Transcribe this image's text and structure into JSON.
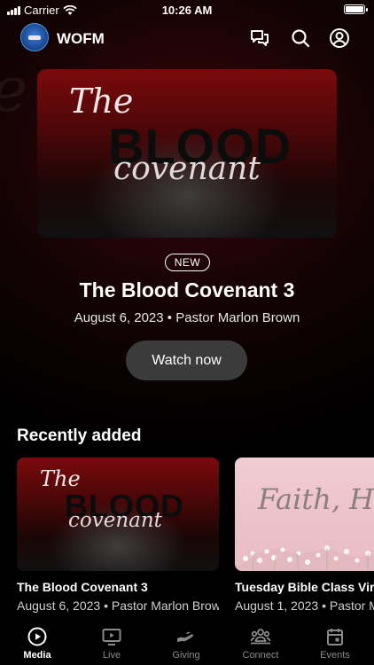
{
  "status_bar": {
    "carrier": "Carrier",
    "time": "10:26 AM"
  },
  "header": {
    "title": "WOFM",
    "icons": [
      "chat-icon",
      "search-icon",
      "profile-icon"
    ]
  },
  "hero": {
    "artwork": {
      "word1": "The",
      "word2": "BLOOD",
      "word3": "covenant"
    },
    "badge": "NEW",
    "title": "The Blood Covenant 3",
    "date": "August 6, 2023",
    "separator": "•",
    "speaker": "Pastor Marlon Brown",
    "button": "Watch now"
  },
  "recently_added": {
    "title": "Recently added",
    "items": [
      {
        "artwork": {
          "word1": "The",
          "word2": "BLOOD",
          "word3": "covenant"
        },
        "title": "The Blood Covenant 3",
        "date": "August 6, 2023",
        "separator": "•",
        "speaker": "Pastor Marlon Brown"
      },
      {
        "artwork": {
          "word1": "Faith, Hope"
        },
        "title": "Tuesday Bible Class Virtual",
        "date": "August 1, 2023",
        "separator": "•",
        "speaker": "Pastor Marlon Brown"
      }
    ]
  },
  "tab_bar": {
    "items": [
      {
        "label": "Media",
        "icon": "play-circle-icon",
        "active": true
      },
      {
        "label": "Live",
        "icon": "tv-play-icon",
        "active": false
      },
      {
        "label": "Giving",
        "icon": "giving-hand-icon",
        "active": false
      },
      {
        "label": "Connect",
        "icon": "group-icon",
        "active": false
      },
      {
        "label": "Events",
        "icon": "calendar-icon",
        "active": false
      }
    ]
  },
  "colors": {
    "accent_red": "#7a0a0c",
    "button_bg": "#3b3b3b",
    "inactive_tab": "#8a8a8a"
  }
}
